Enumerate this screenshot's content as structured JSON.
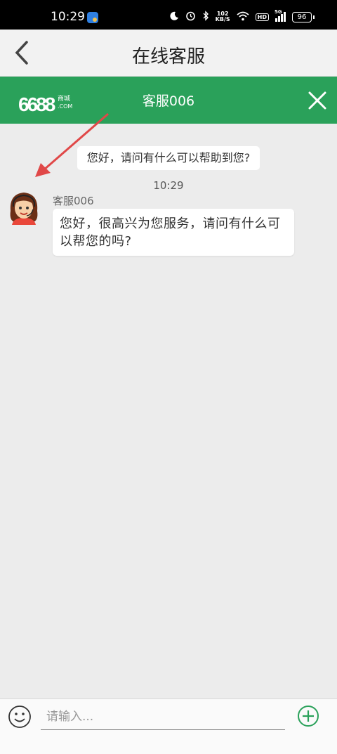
{
  "status_bar": {
    "time": "10:29",
    "net_speed_value": "102",
    "net_speed_unit": "KB/S",
    "hd_label": "HD",
    "signal_label": "5G",
    "battery": "96",
    "icons": [
      "moon-icon",
      "alarm-icon",
      "bluetooth-icon",
      "wifi-icon",
      "signal-icon",
      "battery-icon"
    ]
  },
  "header": {
    "title": "在线客服",
    "back_icon": "chevron-left-icon"
  },
  "agent_bar": {
    "logo_text": "6688",
    "logo_cn": "商城",
    "logo_com": ".COM",
    "agent_name": "客服006",
    "close_icon": "close-icon"
  },
  "chat": {
    "system_message": "您好，请问有什么可以帮助到您?",
    "timestamp": "10:29",
    "messages": [
      {
        "sender": "客服006",
        "text": "您好，很高兴为您服务，请问有什么可以帮您的吗?"
      }
    ]
  },
  "input_bar": {
    "placeholder": "请输入...",
    "emoji_icon": "smiley-icon",
    "plus_icon": "plus-circle-icon"
  },
  "colors": {
    "brand_green": "#2aa15a",
    "annotation_arrow": "#e04848",
    "background": "#ececec"
  }
}
